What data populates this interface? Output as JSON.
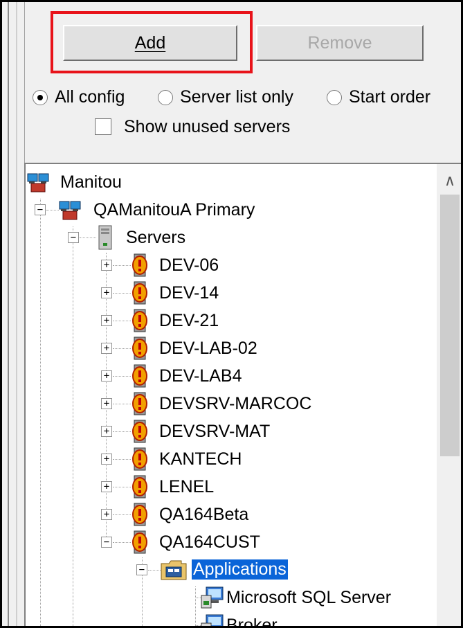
{
  "buttons": {
    "add": "Add",
    "remove": "Remove"
  },
  "view_options": {
    "all_config": "All config",
    "server_list_only": "Server list only",
    "start_order": "Start order",
    "selected": "All config",
    "show_unused_servers": "Show unused servers",
    "show_unused_checked": false
  },
  "tree": {
    "root": "Manitou",
    "primary": "QAManitouA Primary",
    "servers_folder": "Servers",
    "servers": [
      "DEV-06",
      "DEV-14",
      "DEV-21",
      "DEV-LAB-02",
      "DEV-LAB4",
      "DEVSRV-MARCOC",
      "DEVSRV-MAT",
      "KANTECH",
      "LENEL",
      "QA164Beta",
      "QA164CUST"
    ],
    "applications_folder": "Applications",
    "applications": [
      "Microsoft SQL Server",
      "Broker"
    ]
  },
  "colors": {
    "highlight_box": "#e8131a",
    "selection": "#0a64d8"
  },
  "icons": {
    "root": "network-icon",
    "primary": "network-icon",
    "servers": "server-tower-icon",
    "server": "server-alert-icon",
    "applications": "folder-app-icon",
    "application": "app-computer-icon"
  }
}
